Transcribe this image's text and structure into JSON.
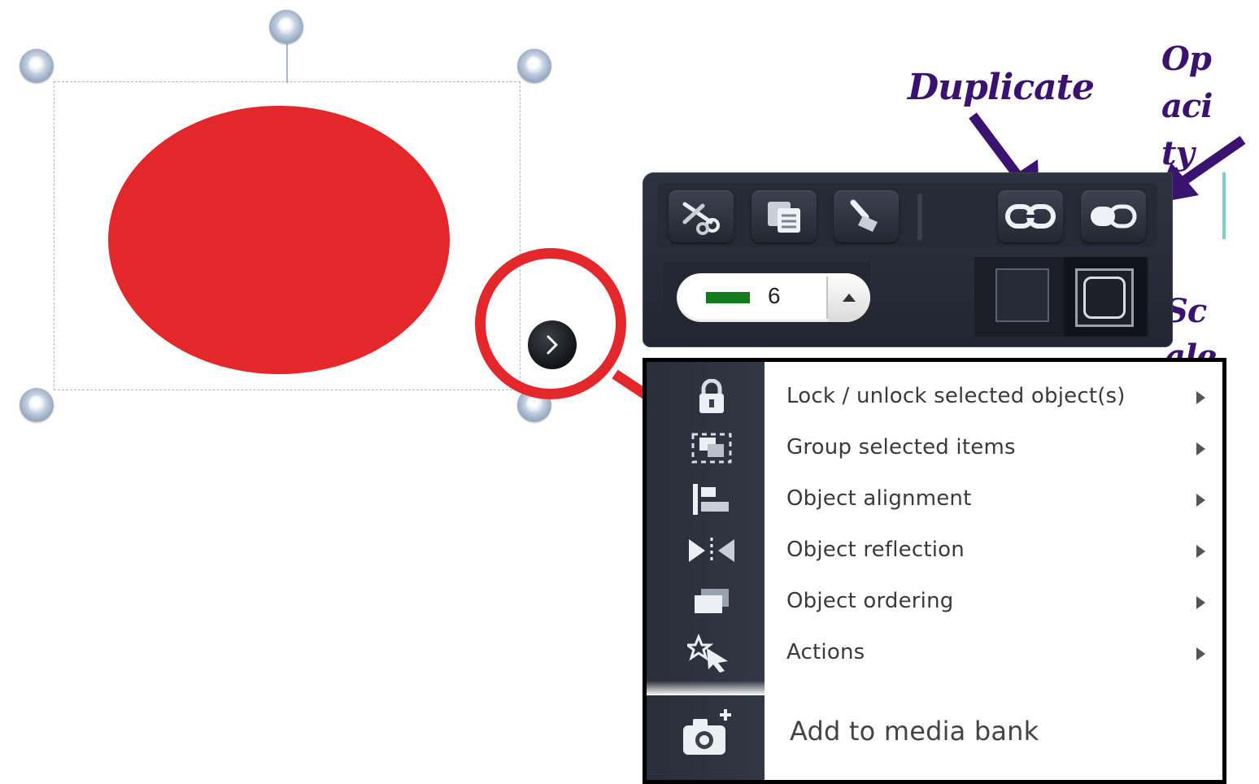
{
  "canvas": {
    "shape": "ellipse",
    "shape_color": "#e3272b",
    "menu_toggle_icon": "chevron-right-icon"
  },
  "annotations": {
    "duplicate": "Duplicate",
    "opacity_lines": [
      "Op",
      "aci",
      "ty"
    ],
    "scale_lines": [
      "Sc",
      "ale"
    ],
    "color": "#3a1270"
  },
  "toolbar": {
    "buttons": [
      {
        "icon": "scissors-icon"
      },
      {
        "icon": "copy-icon"
      },
      {
        "icon": "brush-icon"
      },
      {
        "icon": "duplicate-link-icon"
      },
      {
        "icon": "opacity-icon"
      }
    ],
    "line_width": {
      "value": "6",
      "swatch_color": "#137a1e"
    }
  },
  "context_menu": {
    "items": [
      {
        "label": "Lock / unlock selected object(s)",
        "icon": "lock-icon",
        "has_submenu": true
      },
      {
        "label": "Group selected items",
        "icon": "group-icon",
        "has_submenu": true
      },
      {
        "label": "Object alignment",
        "icon": "align-icon",
        "has_submenu": true
      },
      {
        "label": "Object reflection",
        "icon": "reflect-icon",
        "has_submenu": true
      },
      {
        "label": "Object ordering",
        "icon": "order-icon",
        "has_submenu": true
      },
      {
        "label": "Actions",
        "icon": "magic-cursor-icon",
        "has_submenu": true
      },
      {
        "label": "Add to media bank",
        "icon": "camera-add-icon",
        "has_submenu": false
      }
    ]
  }
}
